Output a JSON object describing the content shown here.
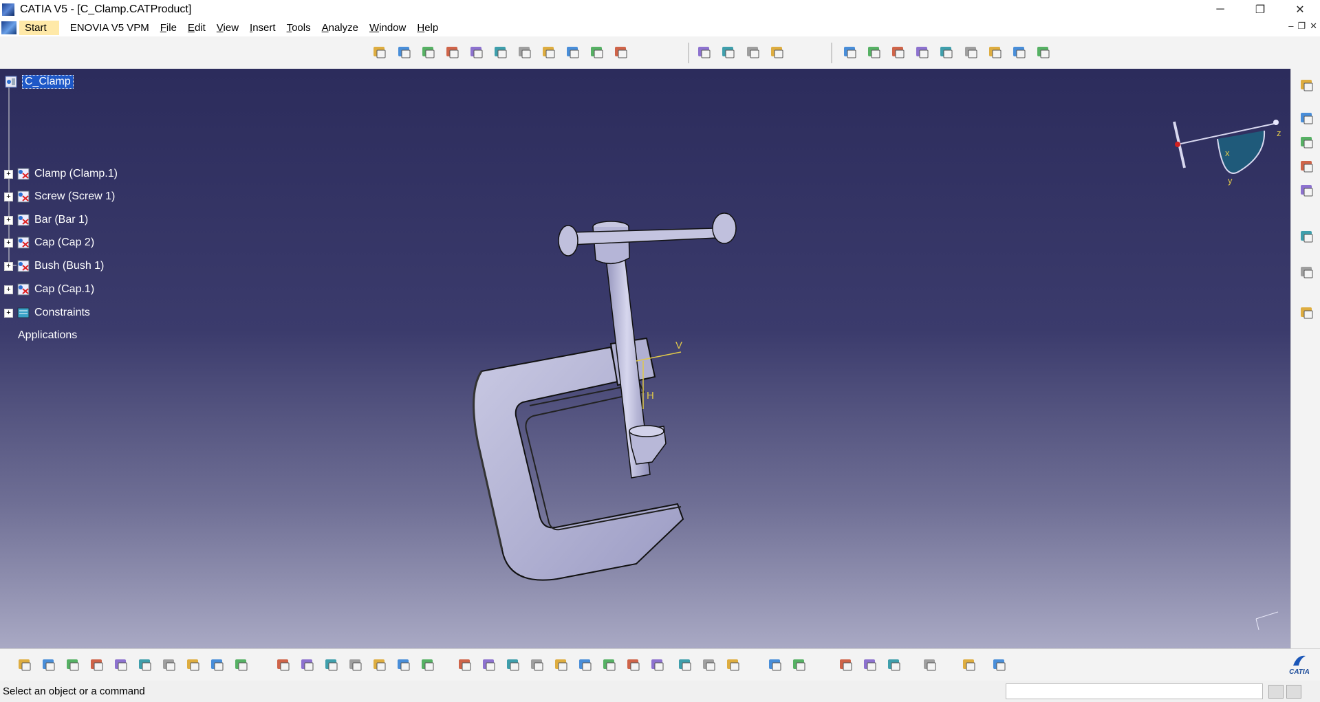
{
  "window": {
    "title": "CATIA V5 - [C_Clamp.CATProduct]",
    "minimize": "─",
    "maximize": "❐",
    "close": "✕"
  },
  "menu": {
    "items": [
      "Start",
      "ENOVIA V5 VPM",
      "File",
      "Edit",
      "View",
      "Insert",
      "Tools",
      "Analyze",
      "Window",
      "Help"
    ],
    "mdi_min": "–",
    "mdi_max": "❐",
    "mdi_close": "✕"
  },
  "tree": {
    "root": "C_Clamp",
    "children": [
      "Clamp (Clamp.1)",
      "Screw (Screw 1)",
      "Bar (Bar 1)",
      "Cap (Cap 2)",
      "Bush (Bush 1)",
      "Cap (Cap.1)"
    ],
    "constraints": "Constraints",
    "applications": "Applications"
  },
  "compass": {
    "x": "x",
    "y": "y",
    "z": "z"
  },
  "model_axes": {
    "v": "V",
    "h": "H"
  },
  "status": {
    "message": "Select an object or a command"
  },
  "brand": {
    "logo_text": "CATIA"
  },
  "colors": {
    "viewport_top": "#2c2c5c",
    "viewport_bottom": "#a9a9c4",
    "selection": "#1e58c7",
    "model": "#b9b9d6"
  },
  "icons": {
    "top_toolbar": [
      "product-icon",
      "component-icon",
      "part-icon",
      "existing-component-icon",
      "replace-icon",
      "graph-tree-icon",
      "numbering-icon",
      "multi-instantiate-icon",
      "reorder-icon",
      "fast-multi-instantiate-icon",
      "manipulate-icon",
      "snap-icon",
      "explode-icon",
      "stop-manipulate-icon",
      "coincidence-icon",
      "contact-icon",
      "offset-icon",
      "angle-icon",
      "fix-icon",
      "fix-together-icon",
      "quick-constraint-icon",
      "flexible-icon",
      "change-constraint-icon",
      "reuse-pattern-icon"
    ],
    "bottom_toolbar": [
      "new-icon",
      "open-icon",
      "save-icon",
      "print-icon",
      "cut-icon",
      "copy-icon",
      "paste-icon",
      "undo-icon",
      "redo-icon",
      "whats-this-icon",
      "formula-icon",
      "comment-icon",
      "catalog-icon",
      "table-icon",
      "tree-icon",
      "knowledge-icon",
      "parameter-icon",
      "fly-mode-icon",
      "fit-all-icon",
      "pan-icon",
      "rotate-icon",
      "zoom-in-icon",
      "zoom-out-icon",
      "normal-view-icon",
      "multi-view-icon",
      "iso-view-icon",
      "shading-icon",
      "hide-show-icon",
      "swap-space-icon",
      "measure-icon",
      "scene-icon",
      "capture-icon",
      "clash-icon",
      "section-icon",
      "distance-icon",
      "inertia-icon",
      "catia-logo-icon"
    ],
    "right_toolbar": [
      "update-icon",
      "drawing-icon",
      "select-icon",
      "annotation-icon",
      "weld-icon",
      "text-icon",
      "flag-note-icon",
      "view-3d-icon"
    ]
  }
}
